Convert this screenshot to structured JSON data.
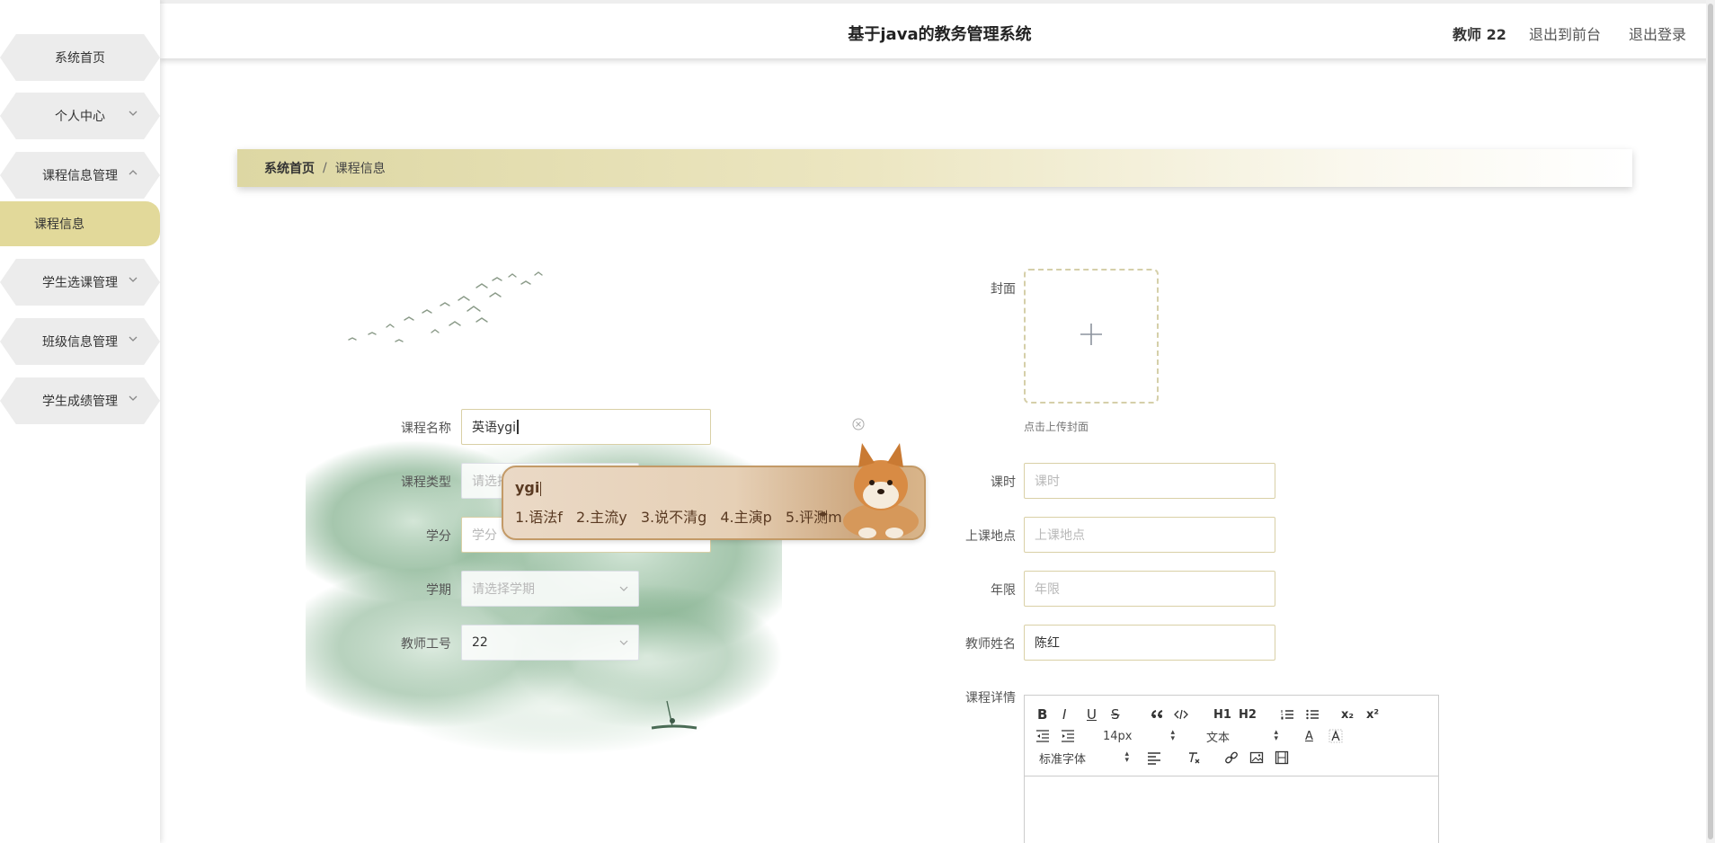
{
  "header": {
    "title": "基于java的教务管理系统",
    "user": "教师 22",
    "to_front": "退出到前台",
    "logout": "退出登录"
  },
  "sidebar": {
    "items": [
      {
        "label": "系统首页"
      },
      {
        "label": "个人中心"
      },
      {
        "label": "课程信息管理"
      },
      {
        "label": "学生选课管理"
      },
      {
        "label": "班级信息管理"
      },
      {
        "label": "学生成绩管理"
      }
    ],
    "sub_active": "课程信息"
  },
  "breadcrumb": {
    "home": "系统首页",
    "separator": "/",
    "current": "课程信息"
  },
  "form": {
    "course_name": {
      "label": "课程名称",
      "value": "英语ygi"
    },
    "course_type": {
      "label": "课程类型",
      "placeholder": "请选择"
    },
    "credit": {
      "label": "学分",
      "placeholder": "学分"
    },
    "semester": {
      "label": "学期",
      "placeholder": "请选择学期"
    },
    "teacher_no": {
      "label": "教师工号",
      "value": "22"
    },
    "cover": {
      "label": "封面",
      "tip": "点击上传封面"
    },
    "hours": {
      "label": "课时",
      "placeholder": "课时"
    },
    "location": {
      "label": "上课地点",
      "placeholder": "上课地点"
    },
    "years": {
      "label": "年限",
      "placeholder": "年限"
    },
    "teacher_name": {
      "label": "教师姓名",
      "value": "陈红"
    },
    "detail": {
      "label": "课程详情"
    }
  },
  "editor": {
    "font_size": "14px",
    "header_select": "文本",
    "font_family": "标准字体",
    "buttons": {
      "bold": "B",
      "italic": "I",
      "underline": "U",
      "strike": "S",
      "h1": "H1",
      "h2": "H2",
      "sub": "x₂",
      "sup": "x²",
      "color": "A"
    }
  },
  "ime": {
    "composition": "ygi",
    "candidates": [
      "1.语法f",
      "2.主流y",
      "3.说不清g",
      "4.主演p",
      "5.评测m"
    ]
  }
}
